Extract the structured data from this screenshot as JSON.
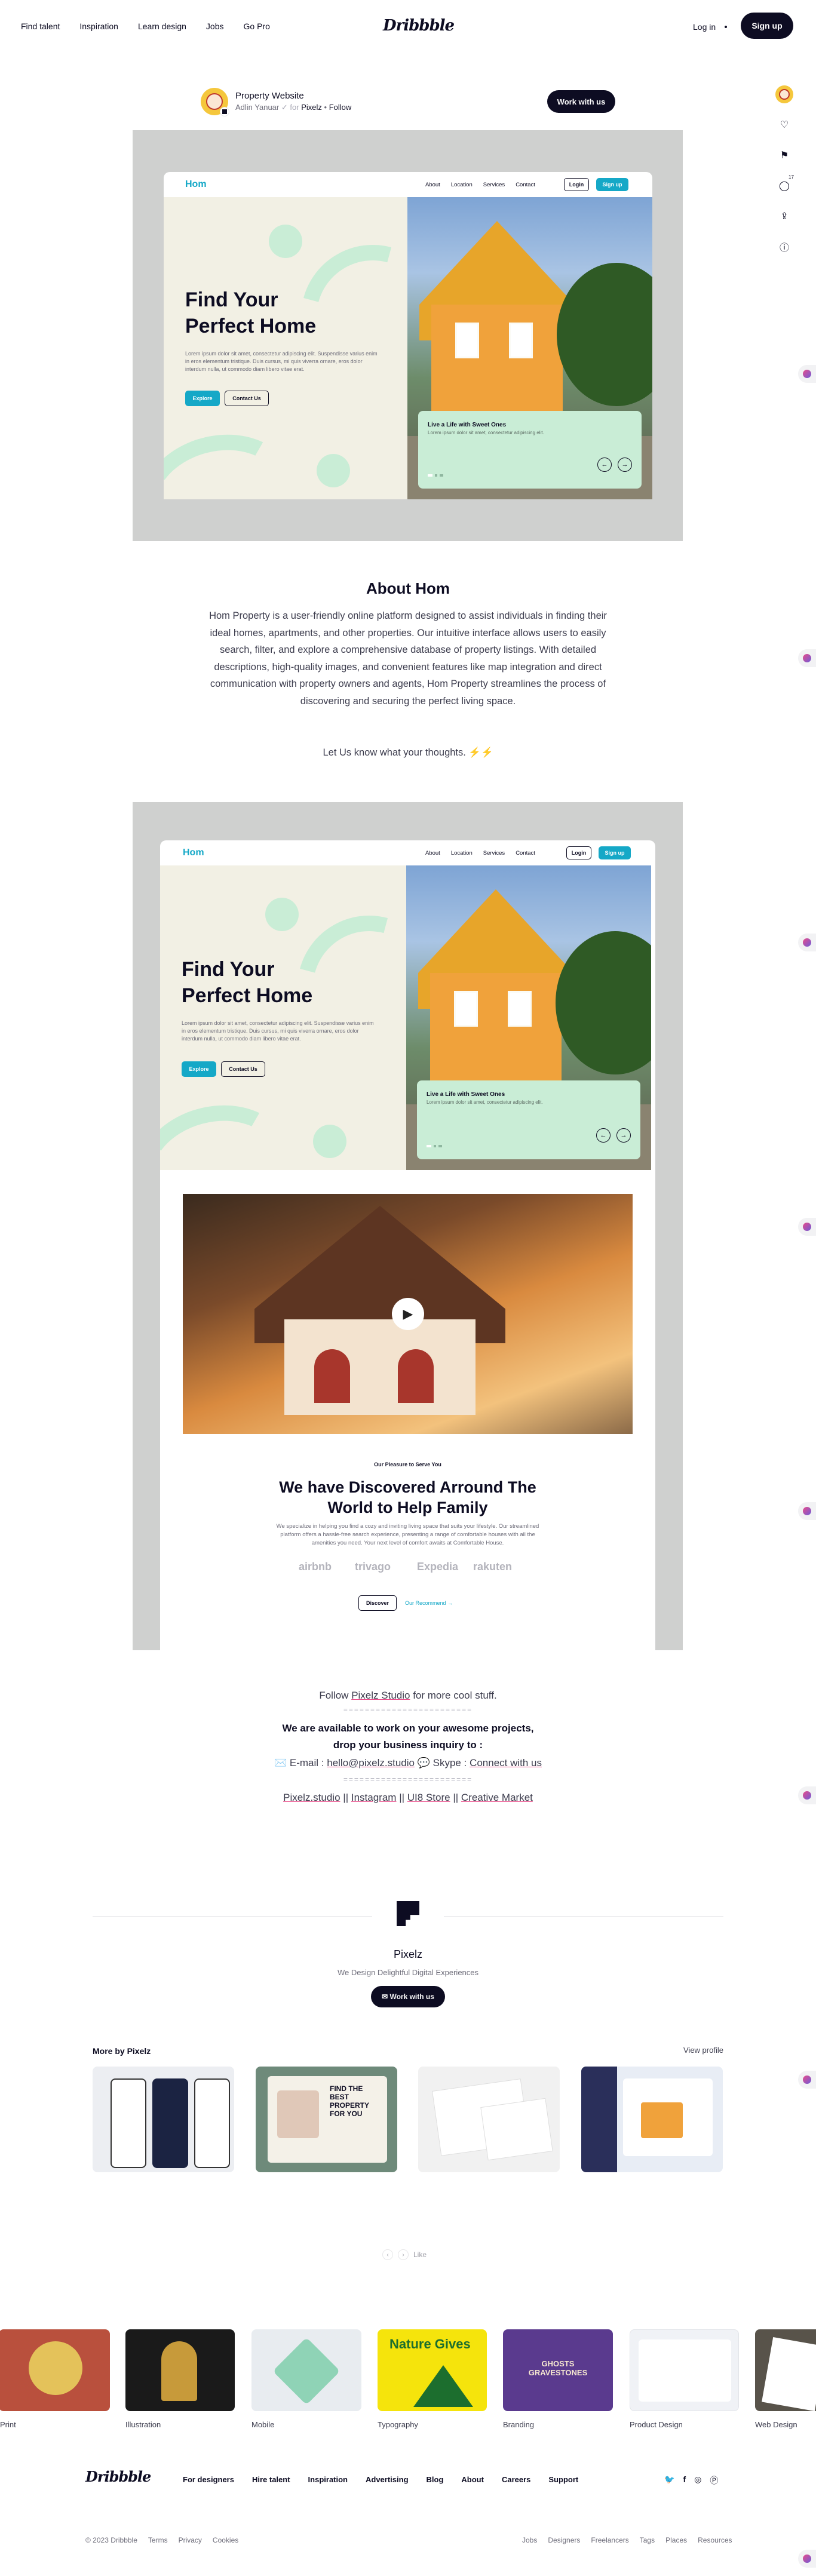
{
  "topnav": {
    "links": [
      "Find talent",
      "Inspiration",
      "Learn design",
      "Jobs",
      "Go Pro"
    ],
    "logo": "Dribbble",
    "login": "Log in",
    "signup": "Sign up"
  },
  "shot": {
    "title": "Property Website",
    "author": "Adlin Yanuar",
    "for_label": "for",
    "team": "Pixelz",
    "follow": "Follow",
    "work_button": "Work with us"
  },
  "rail": {
    "icons": [
      "profile-avatar",
      "heart-icon",
      "bookmark-icon",
      "comment-icon",
      "share-icon",
      "info-icon"
    ],
    "comment_count": "17"
  },
  "mockup": {
    "logo": "Hom",
    "nav": [
      "About",
      "Location",
      "Services",
      "Contact"
    ],
    "login": "Login",
    "signup": "Sign up",
    "hero_title_1": "Find Your",
    "hero_title_2": "Perfect Home",
    "hero_text": "Lorem ipsum dolor sit amet, consectetur adipiscing elit. Suspendisse varius enim in eros elementum tristique. Duis cursus, mi quis viverra ornare, eros dolor interdum nulla, ut commodo diam libero vitae erat.",
    "explore": "Explore",
    "contact": "Contact Us",
    "card_title": "Live a Life with Sweet Ones",
    "card_text": "Lorem ipsum dolor sit amet, consectetur adipiscing elit."
  },
  "about": {
    "title": "About Hom",
    "body": "Hom Property is a user-friendly online platform designed to assist individuals in finding their ideal homes, apartments, and other properties. Our intuitive interface allows users to easily search, filter, and explore a comprehensive database of property listings. With detailed descriptions, high-quality images, and convenient features like map integration and direct communication with property owners and agents, Hom Property streamlines the process of discovering and securing the perfect living space.",
    "cta": "Let Us know what your thoughts. ⚡⚡"
  },
  "discover": {
    "eyebrow": "Our Pleasure to Serve You",
    "title_1": "We have Discovered Arround The",
    "title_2": "World to Help Family",
    "text": "We specialize in helping you find a cozy and inviting living space that suits your lifestyle. Our streamlined platform offers a hassle-free search experience, presenting a range of comfortable houses with all the amenities you need. Your next level of comfort awaits at Comfortable House.",
    "brands": [
      "airbnb",
      "trivago",
      "Expedia",
      "rakuten"
    ],
    "discover_btn": "Discover",
    "recommend": "Our Recommend →"
  },
  "contact_block": {
    "follow_prefix": "Follow",
    "follow_link": "Pixelz Studio",
    "follow_suffix": "for more cool stuff.",
    "separator": "========================",
    "headline_1": "We are available to work on your awesome projects,",
    "headline_2": "drop your business inquiry to :",
    "email_label": "✉️ E-mail :",
    "email": "hello@pixelz.studio",
    "skype_label": "💬 Skype :",
    "skype": "Connect with us",
    "links": [
      "Pixelz.studio",
      "Instagram",
      "UI8 Store",
      "Creative Market"
    ],
    "link_sep": "||"
  },
  "profile": {
    "name": "Pixelz",
    "tagline": "We Design Delightful Digital Experiences",
    "work_button": "✉ Work with us",
    "more_title": "More by Pixelz",
    "view_profile": "View profile"
  },
  "pager": {
    "like": "Like"
  },
  "categories": [
    "Print",
    "Illustration",
    "Mobile",
    "Typography",
    "Branding",
    "Product Design",
    "Web Design"
  ],
  "category_art": {
    "typography": "Nature Gives",
    "branding": "GHOSTS GRAVESTONES",
    "product_title": "FIND THE BEST PROPERTY FOR YOU"
  },
  "footer": {
    "logo": "Dribbble",
    "links": [
      "For designers",
      "Hire talent",
      "Inspiration",
      "Advertising",
      "Blog",
      "About",
      "Careers",
      "Support"
    ],
    "copyright": "© 2023 Dribbble",
    "legal": [
      "Terms",
      "Privacy",
      "Cookies"
    ],
    "directory": [
      "Jobs",
      "Designers",
      "Freelancers",
      "Tags",
      "Places",
      "Resources"
    ]
  },
  "colors": {
    "accent": "#15a8c7",
    "mint": "#c9edd6",
    "cream": "#f2f0e4",
    "dark": "#0d0c22",
    "pink": "#ea4c89"
  }
}
